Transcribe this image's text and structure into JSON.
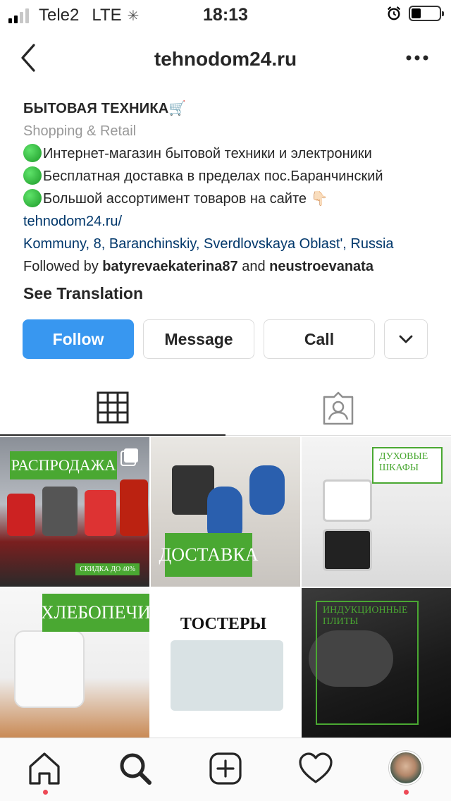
{
  "status_bar": {
    "carrier": "Tele2",
    "network": "LTE",
    "time": "18:13"
  },
  "nav": {
    "title": "tehnodom24.ru"
  },
  "profile": {
    "name": "БЫТОВАЯ ТЕХНИКА🛒",
    "category": "Shopping & Retail",
    "bio_lines": [
      "Интернет-магазин бытовой техники и электроники",
      "Бесплатная доставка в пределах пос.Баранчинский",
      "Большой ассортимент товаров на сайте 👇🏻"
    ],
    "website": "tehnodom24.ru/",
    "address": "Kommuny, 8, Baranchinskiy, Sverdlovskaya Oblast', Russia",
    "followed_by_prefix": "Followed by ",
    "followed_by_user1": "batyrevaekaterina87",
    "followed_by_and": " and ",
    "followed_by_user2": "neustroevanata",
    "see_translation": "See Translation"
  },
  "buttons": {
    "follow": "Follow",
    "message": "Message",
    "call": "Call"
  },
  "posts": [
    {
      "banner": "РАСПРОДАЖА",
      "tag": "СКИДКА ДО 40%"
    },
    {
      "banner": "ДОСТАВКА"
    },
    {
      "banner": "ДУХОВЫЕ ШКАФЫ"
    },
    {
      "banner": "ХЛЕБОПЕЧИ"
    },
    {
      "banner": "ТОСТЕРЫ"
    },
    {
      "banner": "ИНДУКЦИОННЫЕ ПЛИТЫ"
    }
  ],
  "colors": {
    "follow_button": "#3897f0",
    "link": "#00376b",
    "banner_green": "#4aa832",
    "notification_dot": "#ed4956"
  }
}
